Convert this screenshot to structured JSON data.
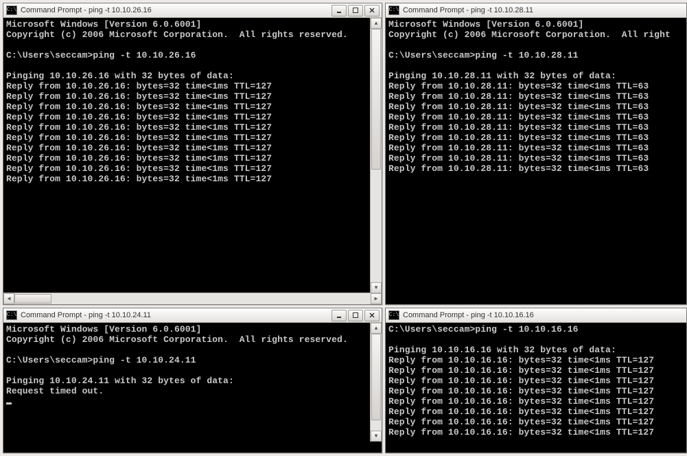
{
  "windows": [
    {
      "id": "win1",
      "title": "Command Prompt - ping  -t 10.10.26.16",
      "showControls": true,
      "showScroll": true,
      "header": [
        "Microsoft Windows [Version 6.0.6001]",
        "Copyright (c) 2006 Microsoft Corporation.  All rights reserved.",
        ""
      ],
      "prompt": "C:\\Users\\seccam>",
      "command": "ping -t 10.10.26.16",
      "statusLine": "Pinging 10.10.26.16 with 32 bytes of data:",
      "replies": [
        "Reply from 10.10.26.16: bytes=32 time<1ms TTL=127",
        "Reply from 10.10.26.16: bytes=32 time<1ms TTL=127",
        "Reply from 10.10.26.16: bytes=32 time<1ms TTL=127",
        "Reply from 10.10.26.16: bytes=32 time<1ms TTL=127",
        "Reply from 10.10.26.16: bytes=32 time<1ms TTL=127",
        "Reply from 10.10.26.16: bytes=32 time<1ms TTL=127",
        "Reply from 10.10.26.16: bytes=32 time<1ms TTL=127",
        "Reply from 10.10.26.16: bytes=32 time<1ms TTL=127",
        "Reply from 10.10.26.16: bytes=32 time<1ms TTL=127",
        "Reply from 10.10.26.16: bytes=32 time<1ms TTL=127"
      ]
    },
    {
      "id": "win2",
      "title": "Command Prompt - ping  -t 10.10.28.11",
      "showControls": false,
      "showScroll": false,
      "header": [
        "Microsoft Windows [Version 6.0.6001]",
        "Copyright (c) 2006 Microsoft Corporation.  All right",
        ""
      ],
      "prompt": "C:\\Users\\seccam>",
      "command": "ping -t 10.10.28.11",
      "statusLine": "Pinging 10.10.28.11 with 32 bytes of data:",
      "replies": [
        "Reply from 10.10.28.11: bytes=32 time<1ms TTL=63",
        "Reply from 10.10.28.11: bytes=32 time<1ms TTL=63",
        "Reply from 10.10.28.11: bytes=32 time<1ms TTL=63",
        "Reply from 10.10.28.11: bytes=32 time<1ms TTL=63",
        "Reply from 10.10.28.11: bytes=32 time<1ms TTL=63",
        "Reply from 10.10.28.11: bytes=32 time<1ms TTL=63",
        "Reply from 10.10.28.11: bytes=32 time<1ms TTL=63",
        "Reply from 10.10.28.11: bytes=32 time<1ms TTL=63",
        "Reply from 10.10.28.11: bytes=32 time<1ms TTL=63"
      ]
    },
    {
      "id": "win3",
      "title": "Command Prompt - ping  -t 10.10.24.11",
      "showControls": true,
      "showScroll": true,
      "header": [
        "Microsoft Windows [Version 6.0.6001]",
        "Copyright (c) 2006 Microsoft Corporation.  All rights reserved.",
        ""
      ],
      "prompt": "C:\\Users\\seccam>",
      "command": "ping -t 10.10.24.11",
      "statusLine": "Pinging 10.10.24.11 with 32 bytes of data:",
      "replies": [
        "Request timed out."
      ],
      "showCursor": true
    },
    {
      "id": "win4",
      "title": "Command Prompt - ping  -t 10.10.16.16",
      "showControls": false,
      "showScroll": false,
      "header": [],
      "prompt": "C:\\Users\\seccam>",
      "command": "ping -t 10.10.16.16",
      "statusLine": "Pinging 10.10.16.16 with 32 bytes of data:",
      "replies": [
        "Reply from 10.10.16.16: bytes=32 time<1ms TTL=127",
        "Reply from 10.10.16.16: bytes=32 time<1ms TTL=127",
        "Reply from 10.10.16.16: bytes=32 time<1ms TTL=127",
        "Reply from 10.10.16.16: bytes=32 time<1ms TTL=127",
        "Reply from 10.10.16.16: bytes=32 time<1ms TTL=127",
        "Reply from 10.10.16.16: bytes=32 time<1ms TTL=127",
        "Reply from 10.10.16.16: bytes=32 time<1ms TTL=127",
        "Reply from 10.10.16.16: bytes=32 time<1ms TTL=127"
      ]
    }
  ],
  "iconGlyph": "C:\\"
}
